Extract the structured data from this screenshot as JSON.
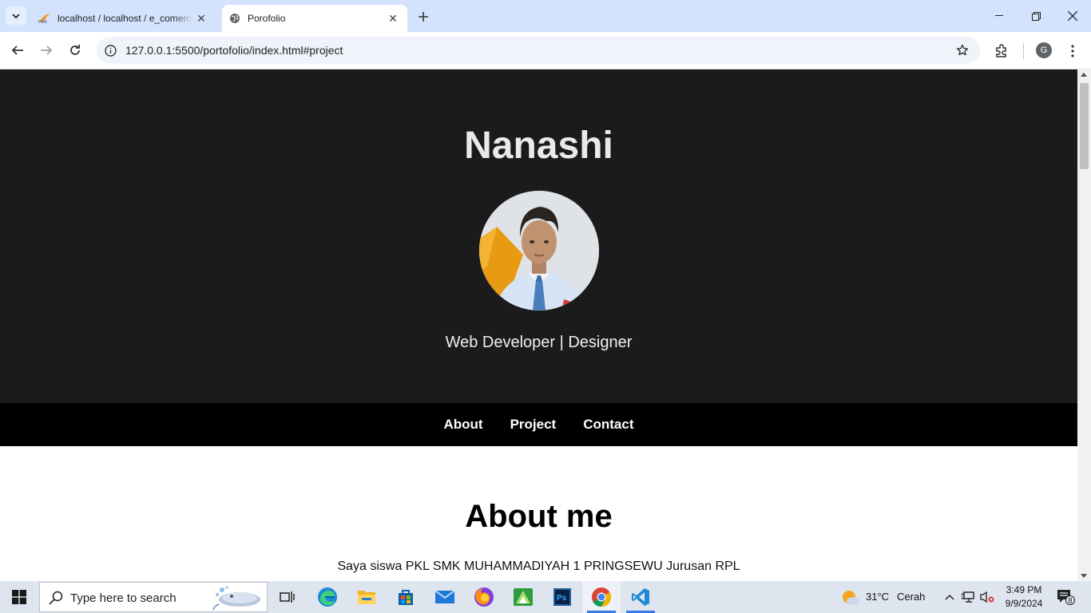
{
  "browser": {
    "tabs": [
      {
        "title": "localhost / localhost / e_comerce",
        "active": false,
        "icon": "phpmyadmin-icon"
      },
      {
        "title": "Porofolio",
        "active": true,
        "icon": "globe-icon"
      }
    ],
    "address": "127.0.0.1:5500/portofolio/index.html#project",
    "profile_initial": "G"
  },
  "page": {
    "name": "Nanashi",
    "tagline": "Web Developer | Designer",
    "nav": [
      {
        "label": "About"
      },
      {
        "label": "Project"
      },
      {
        "label": "Contact"
      }
    ],
    "about_title": "About me",
    "about_text": "Saya siswa PKL SMK MUHAMMADIYAH 1 PRINGSEWU Jurusan RPL",
    "colors": {
      "hero_bg": "#1b1b1b",
      "nav_bg": "#000000",
      "name": "#ece9ec"
    }
  },
  "taskbar": {
    "search_placeholder": "Type here to search",
    "apps": [
      "task-view-icon",
      "edge-icon",
      "file-explorer-icon",
      "store-icon",
      "mail-icon",
      "firefox-icon",
      "inkscape-icon",
      "photoshop-icon",
      "chrome-icon",
      "vscode-icon"
    ],
    "weather_temp": "31°C",
    "weather_desc": "Cerah",
    "time": "3:49 PM",
    "date": "9/9/2024",
    "notification_count": "8"
  }
}
